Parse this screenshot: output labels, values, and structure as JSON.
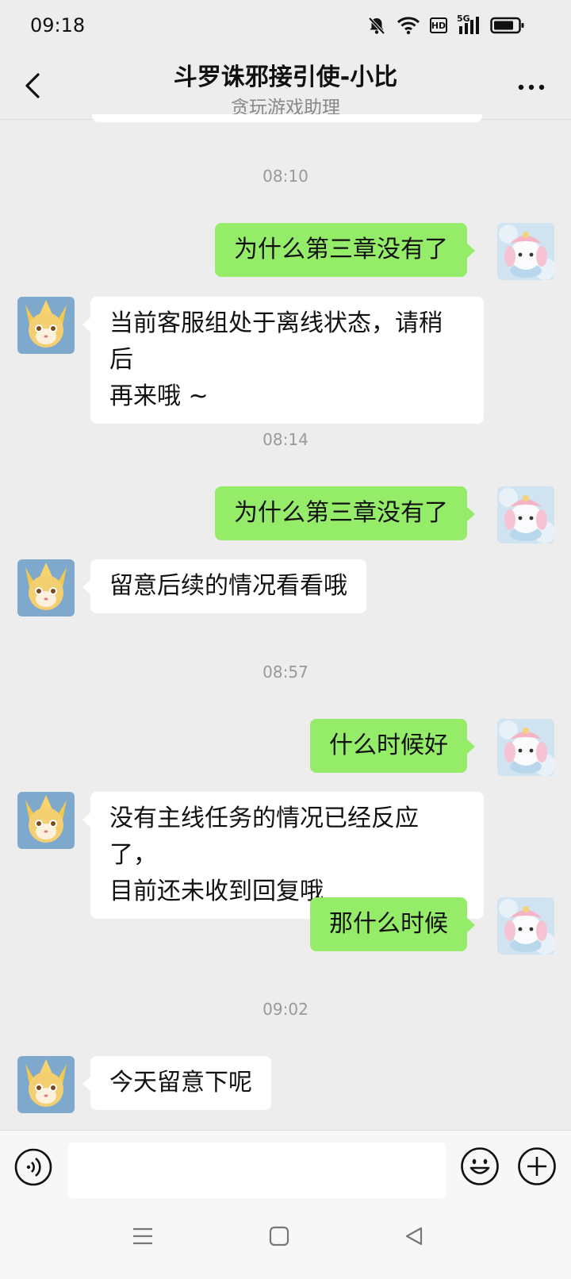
{
  "status_bar": {
    "time": "09:18",
    "network_badge": "HD",
    "network_type": "5G"
  },
  "header": {
    "title": "斗罗诛邪接引使-小比",
    "subtitle": "贪玩游戏助理"
  },
  "messages": [
    {
      "type": "timestamp",
      "text": "08:10"
    },
    {
      "type": "sent",
      "text": "为什么第三章没有了"
    },
    {
      "type": "received",
      "lines": [
        "当前客服组处于离线状态，请稍后",
        "再来哦 ~"
      ]
    },
    {
      "type": "timestamp",
      "text": "08:14"
    },
    {
      "type": "sent",
      "text": "为什么第三章没有了"
    },
    {
      "type": "received",
      "lines": [
        "留意后续的情况看看哦"
      ]
    },
    {
      "type": "timestamp",
      "text": "08:57"
    },
    {
      "type": "sent",
      "text": "什么时候好"
    },
    {
      "type": "received",
      "lines": [
        "没有主线任务的情况已经反应了，",
        "目前还未收到回复哦"
      ]
    },
    {
      "type": "sent",
      "text": "那什么时候"
    },
    {
      "type": "timestamp",
      "text": "09:02"
    },
    {
      "type": "received",
      "lines": [
        "今天留意下呢"
      ]
    }
  ],
  "icons": {
    "back": "chevron-left-icon",
    "more": "more-dots-icon",
    "voice": "voice-icon",
    "emoji": "emoji-icon",
    "add": "plus-icon",
    "mute": "bell-off-icon",
    "wifi": "wifi-icon",
    "battery": "battery-icon"
  },
  "colors": {
    "sent_bubble": "#95ec69",
    "received_bubble": "#ffffff",
    "background": "#ededed"
  }
}
